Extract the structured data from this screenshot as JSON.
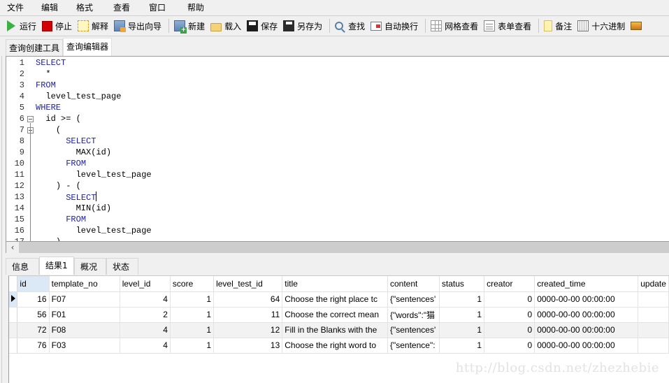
{
  "menubar": {
    "items": [
      "文件",
      "编辑",
      "格式",
      "查看",
      "窗口",
      "帮助"
    ]
  },
  "toolbar": {
    "buttons": [
      {
        "label": "运行",
        "icon": "play-icon"
      },
      {
        "label": "停止",
        "icon": "stop-icon"
      },
      {
        "label": "解释",
        "icon": "explain-icon"
      },
      {
        "label": "导出向导",
        "icon": "export-wizard-icon"
      },
      {
        "label": "新建",
        "icon": "new-query-icon"
      },
      {
        "label": "载入",
        "icon": "folder-open-icon"
      },
      {
        "label": "保存",
        "icon": "save-icon"
      },
      {
        "label": "另存为",
        "icon": "save-as-icon"
      },
      {
        "label": "查找",
        "icon": "search-icon"
      },
      {
        "label": "自动换行",
        "icon": "word-wrap-icon"
      },
      {
        "label": "网格查看",
        "icon": "grid-view-icon"
      },
      {
        "label": "表单查看",
        "icon": "form-view-icon"
      },
      {
        "label": "备注",
        "icon": "memo-icon"
      },
      {
        "label": "十六进制",
        "icon": "hex-icon"
      }
    ]
  },
  "editor_tabs": {
    "items": [
      "查询创建工具",
      "查询编辑器"
    ],
    "active": "查询编辑器"
  },
  "editor": {
    "lines": [
      {
        "n": "1",
        "indent": "",
        "text": "SELECT",
        "kw": true
      },
      {
        "n": "2",
        "indent": "  ",
        "text": "*",
        "kw": false
      },
      {
        "n": "3",
        "indent": "",
        "text": "FROM",
        "kw": true
      },
      {
        "n": "4",
        "indent": "  ",
        "text": "level_test_page",
        "kw": false
      },
      {
        "n": "5",
        "indent": "",
        "text": "WHERE",
        "kw": true
      },
      {
        "n": "6",
        "indent": "  ",
        "text": "id >= (",
        "kw": false
      },
      {
        "n": "7",
        "indent": "    ",
        "text": "(",
        "kw": false
      },
      {
        "n": "8",
        "indent": "      ",
        "text": "SELECT",
        "kw": true
      },
      {
        "n": "9",
        "indent": "        ",
        "text": "MAX(id)",
        "kw": false
      },
      {
        "n": "10",
        "indent": "      ",
        "text": "FROM",
        "kw": true
      },
      {
        "n": "11",
        "indent": "        ",
        "text": "level_test_page",
        "kw": false
      },
      {
        "n": "12",
        "indent": "    ",
        "text": ") - (",
        "kw": false
      },
      {
        "n": "13",
        "indent": "      ",
        "text": "SELECT",
        "kw": true
      },
      {
        "n": "14",
        "indent": "        ",
        "text": "MIN(id)",
        "kw": false
      },
      {
        "n": "15",
        "indent": "      ",
        "text": "FROM",
        "kw": true
      },
      {
        "n": "16",
        "indent": "        ",
        "text": "level_test_page",
        "kw": false
      },
      {
        "n": "17",
        "indent": "    ",
        "text": ")",
        "kw": false
      }
    ]
  },
  "result_tabs": {
    "items": [
      "信息",
      "结果1",
      "概况",
      "状态"
    ],
    "active": "结果1"
  },
  "results": {
    "columns": [
      "id",
      "template_no",
      "level_id",
      "score",
      "level_test_id",
      "title",
      "content",
      "status",
      "creator",
      "created_time",
      "update"
    ],
    "rows": [
      [
        "16",
        "F07",
        "4",
        "1",
        "64",
        "Choose the right place tc",
        "{\"sentences'",
        "1",
        "0",
        "0000-00-00 00:00:00",
        ""
      ],
      [
        "56",
        "F01",
        "2",
        "1",
        "11",
        "Choose the correct mean",
        "{\"words\":\"猫",
        "1",
        "0",
        "0000-00-00 00:00:00",
        ""
      ],
      [
        "72",
        "F08",
        "4",
        "1",
        "12",
        "Fill in the Blanks with the",
        "{\"sentences'",
        "1",
        "0",
        "0000-00-00 00:00:00",
        ""
      ],
      [
        "76",
        "F03",
        "4",
        "1",
        "13",
        "Choose the right word to",
        "{\"sentence\":",
        "1",
        "0",
        "0000-00-00 00:00:00",
        ""
      ]
    ],
    "selected_row": 0,
    "highlighted_row": 2
  },
  "watermark": "http://blog.csdn.net/zhezhebie"
}
